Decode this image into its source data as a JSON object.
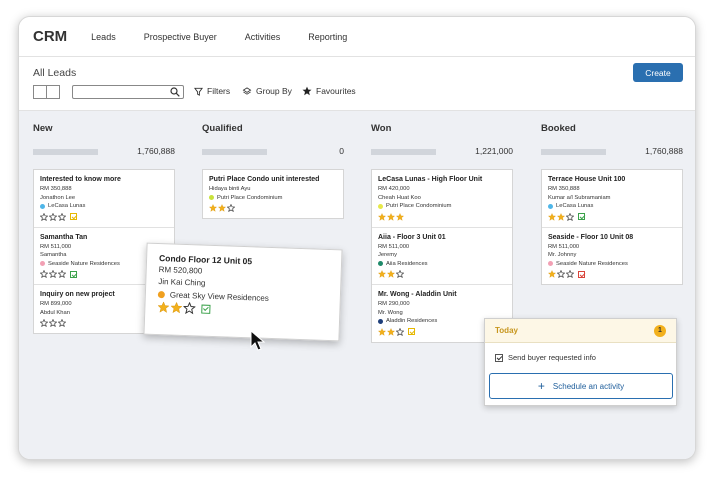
{
  "app": {
    "brand": "CRM",
    "nav": [
      "Leads",
      "Prospective Buyer",
      "Activities",
      "Reporting"
    ]
  },
  "controls": {
    "page_title": "All Leads",
    "create_label": "Create",
    "search_placeholder": "",
    "filters_label": "Filters",
    "groupby_label": "Group By",
    "favourites_label": "Favourites"
  },
  "columns": [
    {
      "title": "New",
      "total": "1,760,888",
      "cards": [
        {
          "title": "Interested to know more",
          "price": "RM 350,888",
          "person": "Jonathon Lee",
          "tag": "LeCasa Lunas",
          "tag_color": "#4fb6e8",
          "stars": 0,
          "check": "yellow"
        },
        {
          "title": "Samantha Tan",
          "price": "RM 511,000",
          "person": "Samantha",
          "tag": "Seaside Nature Residences",
          "tag_color": "#f2a0b4",
          "stars": 0,
          "check": "green"
        },
        {
          "title": "Inquiry on new project",
          "price": "RM 899,000",
          "person": "Abdul Khan",
          "tag": "",
          "tag_color": "",
          "stars": 0,
          "check": ""
        }
      ]
    },
    {
      "title": "Qualified",
      "total": "0",
      "cards": [
        {
          "title": "Putri Place Condo unit interested",
          "price": "",
          "person": "Hidaya binti Ayu",
          "tag": "Putri Place Condominium",
          "tag_color": "#c8e23c",
          "stars": 2,
          "check": ""
        }
      ]
    },
    {
      "title": "Won",
      "total": "1,221,000",
      "cards": [
        {
          "title": "LeCasa Lunas - High Floor Unit",
          "price": "RM 420,000",
          "person": "Cheah Huat Koo",
          "tag": "Putri Place Condominium",
          "tag_color": "#e6e84a",
          "stars": 3,
          "check": ""
        },
        {
          "title": "Aiia - Floor 3 Unit 01",
          "price": "RM 511,000",
          "person": "Jeremy",
          "tag": "Aiia Residences",
          "tag_color": "#1f8a6a",
          "stars": 2,
          "check": ""
        },
        {
          "title": "Mr. Wong - Aladdin Unit",
          "price": "RM 290,000",
          "person": "Mr. Wong",
          "tag": "Aladdin Residences",
          "tag_color": "#1f3f7a",
          "stars": 2,
          "check": "yellow"
        }
      ]
    },
    {
      "title": "Booked",
      "total": "1,760,888",
      "cards": [
        {
          "title": "Terrace House Unit 100",
          "price": "RM 350,888",
          "person": "Kumar a/l Subramaniam",
          "tag": "LeCasa Lunas",
          "tag_color": "#4fb6e8",
          "stars": 2,
          "check": "green"
        },
        {
          "title": "Seaside - Floor 10 Unit 08",
          "price": "RM 511,000",
          "person": "Mr. Johnny",
          "tag": "Seaside Nature Residences",
          "tag_color": "#f2a0b4",
          "stars": 1,
          "check": "red"
        }
      ]
    }
  ],
  "dragging_card": {
    "title": "Condo Floor 12 Unit 05",
    "price": "RM 520,800",
    "person": "Jin Kai Ching",
    "tag": "Great Sky View Residences",
    "tag_color": "#f0a020",
    "stars": 2,
    "check": "green"
  },
  "popup": {
    "title": "Today",
    "badge": "1",
    "task": "Send buyer requested info",
    "button": "Schedule an activity"
  },
  "colors": {
    "accent": "#2a6fb0",
    "star": "#f2b01c",
    "board_bg": "#eef0f4"
  }
}
